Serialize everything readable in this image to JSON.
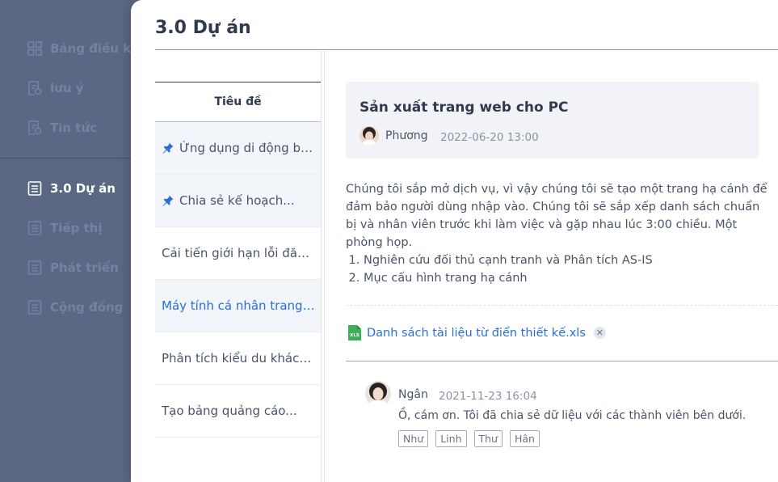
{
  "sidebar": {
    "items": [
      {
        "label": "Bảng điều khiển",
        "icon": "dashboard-icon"
      },
      {
        "label": "lưu ý",
        "icon": "note-icon"
      },
      {
        "label": "Tin tức",
        "icon": "news-icon"
      },
      {
        "label": "3.0 Dự án",
        "icon": "document-icon",
        "active": true
      },
      {
        "label": "Tiếp thị",
        "icon": "document-icon"
      },
      {
        "label": "Phát triển",
        "icon": "document-icon"
      },
      {
        "label": "Cộng đồng",
        "icon": "document-icon"
      }
    ]
  },
  "page": {
    "title": "3.0 Dự án"
  },
  "list": {
    "header": "Tiêu đề",
    "rows": [
      {
        "title": "Ứng dụng di động bị lỗi",
        "pinned": true
      },
      {
        "title": "Chia sẻ kế hoạch...",
        "pinned": true
      },
      {
        "title": "Cải tiến giới hạn lỗi đăng nhập"
      },
      {
        "title": "Máy tính cá nhân trang web",
        "selected": true
      },
      {
        "title": "Phân tích kiểu du khách..."
      },
      {
        "title": "Tạo bảng quảng cáo..."
      }
    ]
  },
  "post": {
    "title": "Sản xuất trang web cho PC",
    "author": "Phương",
    "date": "2022-06-20 13:00",
    "body": "Chúng tôi sắp mở dịch vụ, vì vậy chúng tôi sẽ tạo một trang hạ cánh để đảm bảo người dùng nhập vào. Chúng tôi sẽ sắp xếp danh sách chuẩn bị và nhân viên trước khi làm việc và gặp nhau lúc 3:00 chiều. Một phòng họp.",
    "list": [
      "Nghiên cứu đối thủ cạnh tranh và Phân tích AS-IS",
      "Mục cấu hình trang hạ cánh"
    ],
    "attachment": "Danh sách tài liệu từ điển thiết kế.xls",
    "attachment_icon": "xls-file-icon"
  },
  "comment": {
    "author": "Ngân",
    "date": "2021-11-23 16:04",
    "text": "Ồ, cám ơn. Tôi đã chia sẻ dữ liệu với các thành viên bên dưới.",
    "tags": [
      "Như",
      "Linh",
      "Thư",
      "Hân"
    ]
  },
  "colors": {
    "sidebar_bg": "#5b6883",
    "accent": "#2a6fd6",
    "xls_green": "#3fae5a"
  }
}
